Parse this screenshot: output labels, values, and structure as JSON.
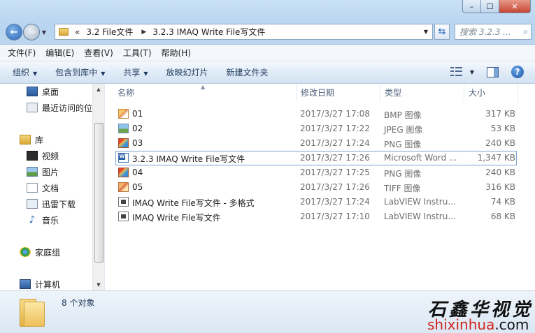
{
  "window": {
    "minimize": "–",
    "maximize": "☐",
    "close": "✕"
  },
  "address": {
    "overflow": "«",
    "segments": [
      "3.2 File文件",
      "3.2.3 IMAQ Write File写文件"
    ]
  },
  "search": {
    "placeholder": "搜索 3.2.3 ..."
  },
  "menu": [
    "文件(F)",
    "编辑(E)",
    "查看(V)",
    "工具(T)",
    "帮助(H)"
  ],
  "toolbar": {
    "organize": "组织",
    "include_in_library": "包含到库中",
    "share": "共享",
    "slideshow": "放映幻灯片",
    "new_folder": "新建文件夹"
  },
  "nav": {
    "favorites": [
      {
        "label": "桌面",
        "icon": "desktop-icon"
      },
      {
        "label": "最近访问的位",
        "icon": "recent-places-icon"
      }
    ],
    "library_label": "库",
    "libraries": [
      {
        "label": "视频",
        "icon": "video-icon"
      },
      {
        "label": "图片",
        "icon": "pictures-icon"
      },
      {
        "label": "文档",
        "icon": "documents-icon"
      },
      {
        "label": "迅雷下载",
        "icon": "download-icon"
      },
      {
        "label": "音乐",
        "icon": "music-icon"
      }
    ],
    "homegroup": "家庭组",
    "computer": "计算机"
  },
  "columns": {
    "name": "名称",
    "modified": "修改日期",
    "type": "类型",
    "size": "大小"
  },
  "files": [
    {
      "name": "01",
      "modified": "2017/3/27 17:08",
      "type": "BMP 图像",
      "size": "317 KB",
      "icon": "bmp-icon"
    },
    {
      "name": "02",
      "modified": "2017/3/27 17:22",
      "type": "JPEG 图像",
      "size": "53 KB",
      "icon": "jpg-icon"
    },
    {
      "name": "03",
      "modified": "2017/3/27 17:24",
      "type": "PNG 图像",
      "size": "240 KB",
      "icon": "png-icon"
    },
    {
      "name": "3.2.3 IMAQ Write File写文件",
      "modified": "2017/3/27 17:26",
      "type": "Microsoft Word ...",
      "size": "1,347 KB",
      "icon": "word-doc-icon",
      "selected": true
    },
    {
      "name": "04",
      "modified": "2017/3/27 17:25",
      "type": "PNG 图像",
      "size": "240 KB",
      "icon": "png-icon"
    },
    {
      "name": "05",
      "modified": "2017/3/27 17:26",
      "type": "TIFF 图像",
      "size": "316 KB",
      "icon": "tiff-icon"
    },
    {
      "name": "IMAQ Write File写文件 - 多格式",
      "modified": "2017/3/27 17:24",
      "type": "LabVIEW Instru...",
      "size": "74 KB",
      "icon": "labview-vi-icon"
    },
    {
      "name": "IMAQ Write File写文件",
      "modified": "2017/3/27 17:10",
      "type": "LabVIEW Instru...",
      "size": "68 KB",
      "icon": "labview-vi-icon"
    }
  ],
  "status": {
    "count": "8 个对象"
  },
  "watermark": {
    "cn": "石鑫华视觉",
    "url_prefix": "shixinhua",
    "url_suffix": ".com"
  }
}
